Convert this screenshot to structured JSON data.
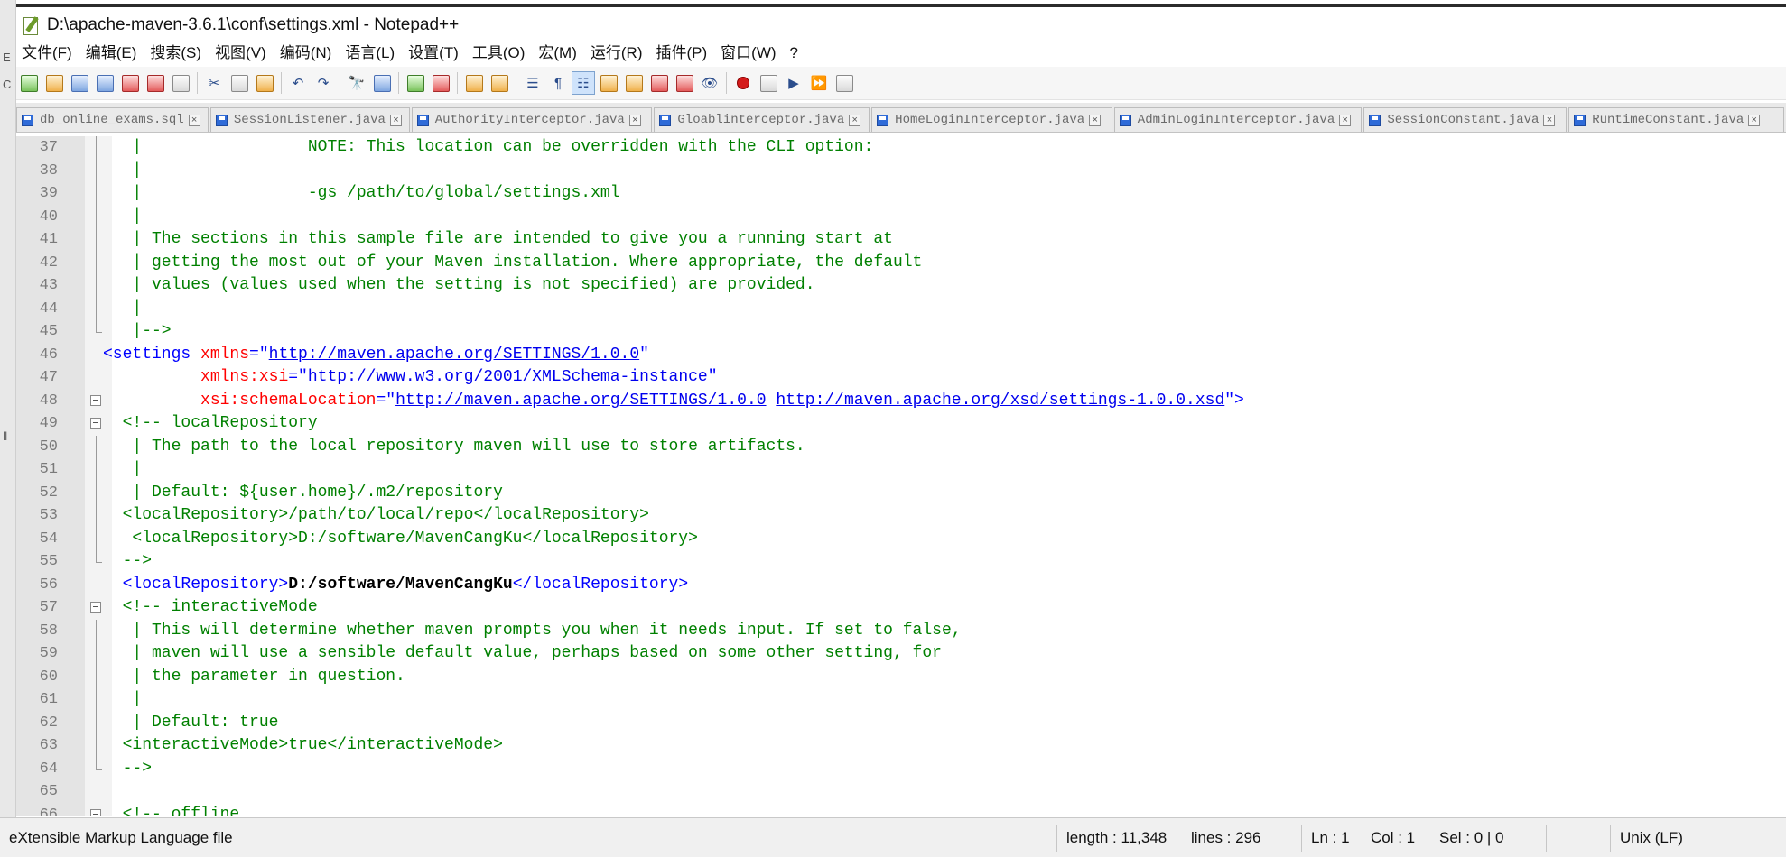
{
  "window": {
    "title": "D:\\apache-maven-3.6.1\\conf\\settings.xml - Notepad++"
  },
  "menu": [
    "文件(F)",
    "编辑(E)",
    "搜索(S)",
    "视图(V)",
    "编码(N)",
    "语言(L)",
    "设置(T)",
    "工具(O)",
    "宏(M)",
    "运行(R)",
    "插件(P)",
    "窗口(W)",
    "?"
  ],
  "tabs": [
    "db_online_exams.sql",
    "SessionListener.java",
    "AuthorityInterceptor.java",
    "Gloablinterceptor.java",
    "HomeLoginInterceptor.java",
    "AdminLoginInterceptor.java",
    "SessionConstant.java",
    "RuntimeConstant.java"
  ],
  "code_lines": [
    {
      "n": "37",
      "fold": "vline",
      "segs": [
        {
          "t": "   |                 NOTE: This location can be overridden with the CLI option:",
          "c": "cm"
        }
      ]
    },
    {
      "n": "38",
      "fold": "vline",
      "segs": [
        {
          "t": "   |",
          "c": "cm"
        }
      ]
    },
    {
      "n": "39",
      "fold": "vline",
      "segs": [
        {
          "t": "   |                 -gs /path/to/global/settings.xml",
          "c": "cm"
        }
      ]
    },
    {
      "n": "40",
      "fold": "vline",
      "segs": [
        {
          "t": "   |",
          "c": "cm"
        }
      ]
    },
    {
      "n": "41",
      "fold": "vline",
      "segs": [
        {
          "t": "   | The sections in this sample file are intended to give you a running start at",
          "c": "cm"
        }
      ]
    },
    {
      "n": "42",
      "fold": "vline",
      "segs": [
        {
          "t": "   | getting the most out of your Maven installation. Where appropriate, the default",
          "c": "cm"
        }
      ]
    },
    {
      "n": "43",
      "fold": "vline",
      "segs": [
        {
          "t": "   | values (values used when the setting is not specified) are provided.",
          "c": "cm"
        }
      ]
    },
    {
      "n": "44",
      "fold": "vline",
      "segs": [
        {
          "t": "   |",
          "c": "cm"
        }
      ]
    },
    {
      "n": "45",
      "fold": "end",
      "segs": [
        {
          "t": "   |-->",
          "c": "cm"
        }
      ]
    },
    {
      "n": "46",
      "fold": "",
      "segs": [
        {
          "t": "<settings ",
          "c": "tg"
        },
        {
          "t": "xmlns",
          "c": "at"
        },
        {
          "t": "=\"",
          "c": "tg"
        },
        {
          "t": "http://maven.apache.org/SETTINGS/1.0.0",
          "c": "ln"
        },
        {
          "t": "\"",
          "c": "tg"
        }
      ]
    },
    {
      "n": "47",
      "fold": "",
      "segs": [
        {
          "t": "          ",
          "c": "tg"
        },
        {
          "t": "xmlns:xsi",
          "c": "at"
        },
        {
          "t": "=\"",
          "c": "tg"
        },
        {
          "t": "http://www.w3.org/2001/XMLSchema-instance",
          "c": "ln"
        },
        {
          "t": "\"",
          "c": "tg"
        }
      ]
    },
    {
      "n": "48",
      "fold": "box",
      "segs": [
        {
          "t": "          ",
          "c": "tg"
        },
        {
          "t": "xsi:schemaLocation",
          "c": "at"
        },
        {
          "t": "=\"",
          "c": "tg"
        },
        {
          "t": "http://maven.apache.org/SETTINGS/1.0.0",
          "c": "ln"
        },
        {
          "t": " ",
          "c": "tg"
        },
        {
          "t": "http://maven.apache.org/xsd/settings-1.0.0.xsd",
          "c": "ln"
        },
        {
          "t": "\">",
          "c": "tg"
        }
      ]
    },
    {
      "n": "49",
      "fold": "box",
      "segs": [
        {
          "t": "  <!-- localRepository",
          "c": "cm"
        }
      ]
    },
    {
      "n": "50",
      "fold": "vline",
      "segs": [
        {
          "t": "   | The path to the local repository maven will use to store artifacts.",
          "c": "cm"
        }
      ]
    },
    {
      "n": "51",
      "fold": "vline",
      "segs": [
        {
          "t": "   |",
          "c": "cm"
        }
      ]
    },
    {
      "n": "52",
      "fold": "vline",
      "segs": [
        {
          "t": "   | Default: ${user.home}/.m2/repository",
          "c": "cm"
        }
      ]
    },
    {
      "n": "53",
      "fold": "vline",
      "segs": [
        {
          "t": "  <localRepository>/path/to/local/repo</localRepository>",
          "c": "cm"
        }
      ]
    },
    {
      "n": "54",
      "fold": "vline",
      "segs": [
        {
          "t": "   <localRepository>D:/software/MavenCangKu</localRepository>",
          "c": "cm"
        }
      ]
    },
    {
      "n": "55",
      "fold": "end",
      "segs": [
        {
          "t": "  -->",
          "c": "cm"
        }
      ]
    },
    {
      "n": "56",
      "fold": "",
      "segs": [
        {
          "t": "  <localRepository>",
          "c": "tg"
        },
        {
          "t": "D:/software/MavenCangKu",
          "c": "tx"
        },
        {
          "t": "</localRepository>",
          "c": "tg"
        }
      ]
    },
    {
      "n": "57",
      "fold": "box",
      "segs": [
        {
          "t": "  <!-- interactiveMode",
          "c": "cm"
        }
      ]
    },
    {
      "n": "58",
      "fold": "vline",
      "segs": [
        {
          "t": "   | This will determine whether maven prompts you when it needs input. If set to false,",
          "c": "cm"
        }
      ]
    },
    {
      "n": "59",
      "fold": "vline",
      "segs": [
        {
          "t": "   | maven will use a sensible default value, perhaps based on some other setting, for",
          "c": "cm"
        }
      ]
    },
    {
      "n": "60",
      "fold": "vline",
      "segs": [
        {
          "t": "   | the parameter in question.",
          "c": "cm"
        }
      ]
    },
    {
      "n": "61",
      "fold": "vline",
      "segs": [
        {
          "t": "   |",
          "c": "cm"
        }
      ]
    },
    {
      "n": "62",
      "fold": "vline",
      "segs": [
        {
          "t": "   | Default: true",
          "c": "cm"
        }
      ]
    },
    {
      "n": "63",
      "fold": "vline",
      "segs": [
        {
          "t": "  <interactiveMode>true</interactiveMode>",
          "c": "cm"
        }
      ]
    },
    {
      "n": "64",
      "fold": "end",
      "segs": [
        {
          "t": "  -->",
          "c": "cm"
        }
      ]
    },
    {
      "n": "65",
      "fold": "",
      "segs": [
        {
          "t": "",
          "c": "cm"
        }
      ]
    },
    {
      "n": "66",
      "fold": "box",
      "segs": [
        {
          "t": "  <!-- offline",
          "c": "cm"
        }
      ]
    }
  ],
  "status": {
    "file_type": "eXtensible Markup Language file",
    "length": "length : 11,348",
    "lines": "lines : 296",
    "ln": "Ln : 1",
    "col": "Col : 1",
    "sel": "Sel : 0 | 0",
    "eol": "Unix (LF)"
  }
}
